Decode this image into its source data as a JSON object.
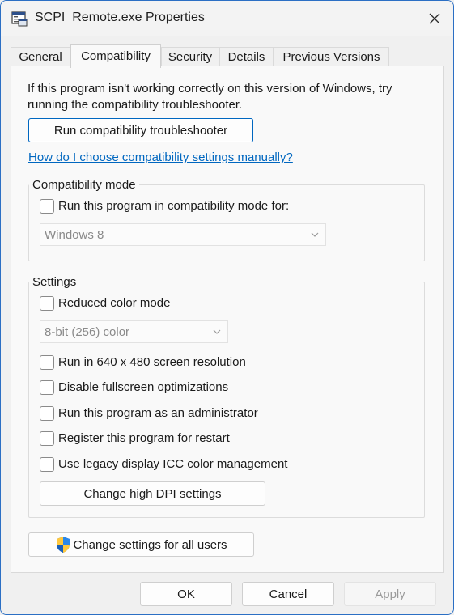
{
  "window": {
    "title": "SCPI_Remote.exe Properties",
    "close_glyph": "✕",
    "accent_color": "#0067c0"
  },
  "tabs": [
    {
      "label": "General"
    },
    {
      "label": "Compatibility",
      "active": true
    },
    {
      "label": "Security"
    },
    {
      "label": "Details"
    },
    {
      "label": "Previous Versions"
    }
  ],
  "compatibility": {
    "description": "If this program isn't working correctly on this version of Windows, try running the compatibility troubleshooter.",
    "troubleshooter_button": "Run compatibility troubleshooter",
    "manual_link": "How do I choose compatibility settings manually?",
    "mode_group": {
      "label": "Compatibility mode",
      "checkbox_label": "Run this program in compatibility mode for:",
      "checked": false,
      "os_select": "Windows 8"
    },
    "settings_group": {
      "label": "Settings",
      "reduced_color": {
        "label": "Reduced color mode",
        "checked": false
      },
      "color_select": "8-bit (256) color",
      "options": [
        {
          "label": "Run in 640 x 480 screen resolution",
          "checked": false
        },
        {
          "label": "Disable fullscreen optimizations",
          "checked": false
        },
        {
          "label": "Run this program as an administrator",
          "checked": false
        },
        {
          "label": "Register this program for restart",
          "checked": false
        },
        {
          "label": "Use legacy display ICC color management",
          "checked": false
        }
      ],
      "dpi_button": "Change high DPI settings"
    },
    "all_users_button": "Change settings for all users"
  },
  "dialog_buttons": {
    "ok": "OK",
    "cancel": "Cancel",
    "apply": "Apply"
  },
  "icons": {
    "app": "application-window-icon",
    "shield": "uac-shield-icon",
    "chevron": "chevron-down-icon"
  }
}
